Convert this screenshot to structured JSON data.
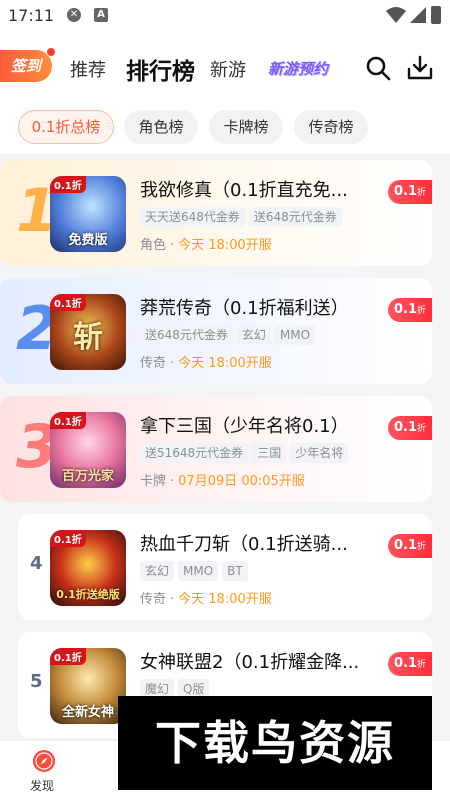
{
  "status_bar": {
    "time": "17:11",
    "icon1": "x-circle-icon",
    "icon2": "a-box-icon"
  },
  "header": {
    "signin_label": "签到",
    "tabs": [
      {
        "label": "推荐"
      },
      {
        "label": "排行榜"
      },
      {
        "label": "新游"
      },
      {
        "label": "新游预约"
      }
    ]
  },
  "filters": [
    {
      "label": "0.1折总榜"
    },
    {
      "label": "角色榜"
    },
    {
      "label": "卡牌榜"
    },
    {
      "label": "传奇榜"
    }
  ],
  "games": [
    {
      "rank": "1",
      "thumb_tag": "0.1折",
      "thumb_caption": "免费版",
      "title": "我欲修真（0.1折直充免...",
      "tags": [
        "天天送648代金券",
        "送648元代金券"
      ],
      "category": "角色",
      "time": "今天 18:00开服",
      "badge": "0.1",
      "badge_unit": "折"
    },
    {
      "rank": "2",
      "thumb_tag": "0.1折",
      "thumb_caption": "斩",
      "title": "莽荒传奇（0.1折福利送）",
      "tags": [
        "送648元代金券",
        "玄幻",
        "MMO"
      ],
      "category": "传奇",
      "time": "今天 18:00开服",
      "badge": "0.1",
      "badge_unit": "折"
    },
    {
      "rank": "3",
      "thumb_tag": "0.1折",
      "thumb_caption": "百万光家",
      "title": "拿下三国（少年名将0.1）",
      "tags": [
        "送51648元代金券",
        "三国",
        "少年名将"
      ],
      "category": "卡牌",
      "time": "07月09日 00:05开服",
      "badge": "0.1",
      "badge_unit": "折"
    },
    {
      "rank": "4",
      "thumb_tag": "0.1折",
      "thumb_caption": "0.1折送绝版",
      "title": "热血千刀斩（0.1折送骑...",
      "tags": [
        "玄幻",
        "MMO",
        "BT"
      ],
      "category": "传奇",
      "time": "今天 18:00开服",
      "badge": "0.1",
      "badge_unit": "折"
    },
    {
      "rank": "5",
      "thumb_tag": "0.1折",
      "thumb_caption": "全新女神",
      "title": "女神联盟2（0.1折耀金降...",
      "tags": [
        "魔幻",
        "Q版"
      ],
      "category": "",
      "time": "",
      "badge": "0.1",
      "badge_unit": "折"
    }
  ],
  "bottom_nav": {
    "discover_label": "发现"
  },
  "watermark": "下载鸟资源",
  "colors": {
    "accent": "#ff5a34",
    "badge": "#ff2d3a",
    "time": "#ff9a1e",
    "special_tab": "#7b5cff"
  }
}
